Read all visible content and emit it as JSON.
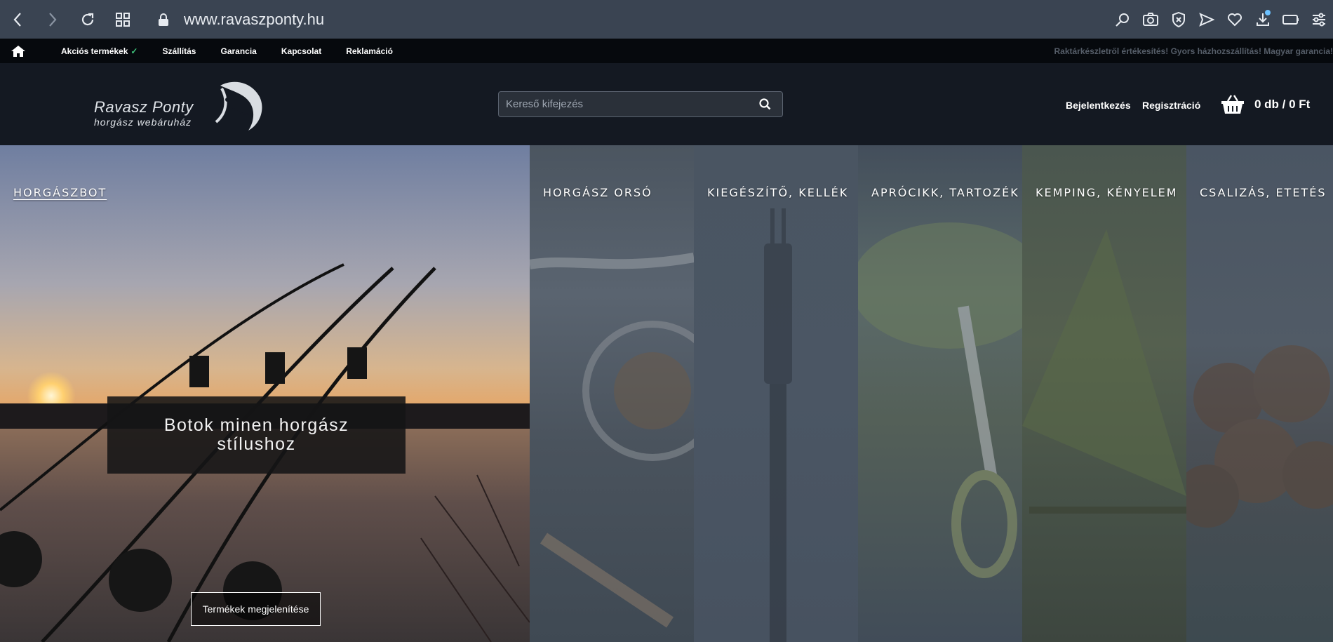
{
  "browser": {
    "url": "www.ravaszponty.hu",
    "icons": [
      "back-icon",
      "forward-icon",
      "reload-icon",
      "grid-icon",
      "lock-icon",
      "zoom-icon",
      "camera-icon",
      "shield-icon",
      "send-icon",
      "heart-icon",
      "download-icon",
      "battery-icon",
      "settings-icon"
    ]
  },
  "topbar": {
    "links": [
      {
        "label": "Akciós termékek"
      },
      {
        "label": "Szállítás"
      },
      {
        "label": "Garancia"
      },
      {
        "label": "Kapcsolat"
      },
      {
        "label": "Reklamáció"
      }
    ],
    "promo": "Raktárkészletről értékesítés! Gyors házhozszállítás! Magyar garancia!"
  },
  "header": {
    "logo_line1": "Ravasz Ponty",
    "logo_line2": "horgász webáruház",
    "search_placeholder": "Kereső kifejezés",
    "login": "Bejelentkezés",
    "register": "Regisztráció",
    "cart": "0 db / 0 Ft"
  },
  "hero": {
    "main": {
      "category": "HORGÁSZBOT",
      "caption": "Botok minen horgász stílushoz",
      "cta": "Termékek megjelenítése"
    },
    "categories": [
      {
        "label": "HORGÁSZ ORSÓ"
      },
      {
        "label": "KIEGÉSZÍTŐ, KELLÉK"
      },
      {
        "label": "APRÓCIKK, TARTOZÉK"
      },
      {
        "label": "KEMPING, KÉNYELEM"
      },
      {
        "label": "CSALIZÁS, ETETÉS"
      }
    ]
  },
  "colors": {
    "accent_check": "#3ec27a",
    "header_bg": "#141922",
    "topbar_bg": "#06090d"
  }
}
